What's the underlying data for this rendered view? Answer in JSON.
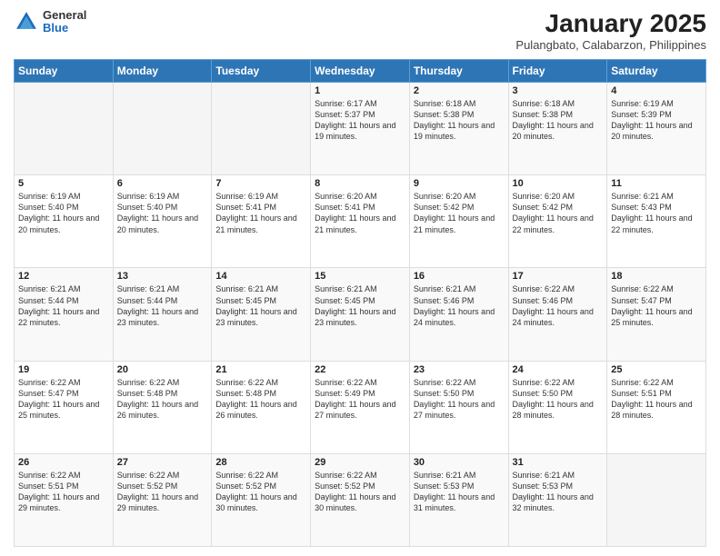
{
  "header": {
    "logo_general": "General",
    "logo_blue": "Blue",
    "title": "January 2025",
    "subtitle": "Pulangbato, Calabarzon, Philippines"
  },
  "calendar": {
    "days_of_week": [
      "Sunday",
      "Monday",
      "Tuesday",
      "Wednesday",
      "Thursday",
      "Friday",
      "Saturday"
    ],
    "weeks": [
      [
        {
          "day": "",
          "info": ""
        },
        {
          "day": "",
          "info": ""
        },
        {
          "day": "",
          "info": ""
        },
        {
          "day": "1",
          "info": "Sunrise: 6:17 AM\nSunset: 5:37 PM\nDaylight: 11 hours and 19 minutes."
        },
        {
          "day": "2",
          "info": "Sunrise: 6:18 AM\nSunset: 5:38 PM\nDaylight: 11 hours and 19 minutes."
        },
        {
          "day": "3",
          "info": "Sunrise: 6:18 AM\nSunset: 5:38 PM\nDaylight: 11 hours and 20 minutes."
        },
        {
          "day": "4",
          "info": "Sunrise: 6:19 AM\nSunset: 5:39 PM\nDaylight: 11 hours and 20 minutes."
        }
      ],
      [
        {
          "day": "5",
          "info": "Sunrise: 6:19 AM\nSunset: 5:40 PM\nDaylight: 11 hours and 20 minutes."
        },
        {
          "day": "6",
          "info": "Sunrise: 6:19 AM\nSunset: 5:40 PM\nDaylight: 11 hours and 20 minutes."
        },
        {
          "day": "7",
          "info": "Sunrise: 6:19 AM\nSunset: 5:41 PM\nDaylight: 11 hours and 21 minutes."
        },
        {
          "day": "8",
          "info": "Sunrise: 6:20 AM\nSunset: 5:41 PM\nDaylight: 11 hours and 21 minutes."
        },
        {
          "day": "9",
          "info": "Sunrise: 6:20 AM\nSunset: 5:42 PM\nDaylight: 11 hours and 21 minutes."
        },
        {
          "day": "10",
          "info": "Sunrise: 6:20 AM\nSunset: 5:42 PM\nDaylight: 11 hours and 22 minutes."
        },
        {
          "day": "11",
          "info": "Sunrise: 6:21 AM\nSunset: 5:43 PM\nDaylight: 11 hours and 22 minutes."
        }
      ],
      [
        {
          "day": "12",
          "info": "Sunrise: 6:21 AM\nSunset: 5:44 PM\nDaylight: 11 hours and 22 minutes."
        },
        {
          "day": "13",
          "info": "Sunrise: 6:21 AM\nSunset: 5:44 PM\nDaylight: 11 hours and 23 minutes."
        },
        {
          "day": "14",
          "info": "Sunrise: 6:21 AM\nSunset: 5:45 PM\nDaylight: 11 hours and 23 minutes."
        },
        {
          "day": "15",
          "info": "Sunrise: 6:21 AM\nSunset: 5:45 PM\nDaylight: 11 hours and 23 minutes."
        },
        {
          "day": "16",
          "info": "Sunrise: 6:21 AM\nSunset: 5:46 PM\nDaylight: 11 hours and 24 minutes."
        },
        {
          "day": "17",
          "info": "Sunrise: 6:22 AM\nSunset: 5:46 PM\nDaylight: 11 hours and 24 minutes."
        },
        {
          "day": "18",
          "info": "Sunrise: 6:22 AM\nSunset: 5:47 PM\nDaylight: 11 hours and 25 minutes."
        }
      ],
      [
        {
          "day": "19",
          "info": "Sunrise: 6:22 AM\nSunset: 5:47 PM\nDaylight: 11 hours and 25 minutes."
        },
        {
          "day": "20",
          "info": "Sunrise: 6:22 AM\nSunset: 5:48 PM\nDaylight: 11 hours and 26 minutes."
        },
        {
          "day": "21",
          "info": "Sunrise: 6:22 AM\nSunset: 5:48 PM\nDaylight: 11 hours and 26 minutes."
        },
        {
          "day": "22",
          "info": "Sunrise: 6:22 AM\nSunset: 5:49 PM\nDaylight: 11 hours and 27 minutes."
        },
        {
          "day": "23",
          "info": "Sunrise: 6:22 AM\nSunset: 5:50 PM\nDaylight: 11 hours and 27 minutes."
        },
        {
          "day": "24",
          "info": "Sunrise: 6:22 AM\nSunset: 5:50 PM\nDaylight: 11 hours and 28 minutes."
        },
        {
          "day": "25",
          "info": "Sunrise: 6:22 AM\nSunset: 5:51 PM\nDaylight: 11 hours and 28 minutes."
        }
      ],
      [
        {
          "day": "26",
          "info": "Sunrise: 6:22 AM\nSunset: 5:51 PM\nDaylight: 11 hours and 29 minutes."
        },
        {
          "day": "27",
          "info": "Sunrise: 6:22 AM\nSunset: 5:52 PM\nDaylight: 11 hours and 29 minutes."
        },
        {
          "day": "28",
          "info": "Sunrise: 6:22 AM\nSunset: 5:52 PM\nDaylight: 11 hours and 30 minutes."
        },
        {
          "day": "29",
          "info": "Sunrise: 6:22 AM\nSunset: 5:52 PM\nDaylight: 11 hours and 30 minutes."
        },
        {
          "day": "30",
          "info": "Sunrise: 6:21 AM\nSunset: 5:53 PM\nDaylight: 11 hours and 31 minutes."
        },
        {
          "day": "31",
          "info": "Sunrise: 6:21 AM\nSunset: 5:53 PM\nDaylight: 11 hours and 32 minutes."
        },
        {
          "day": "",
          "info": ""
        }
      ]
    ]
  }
}
